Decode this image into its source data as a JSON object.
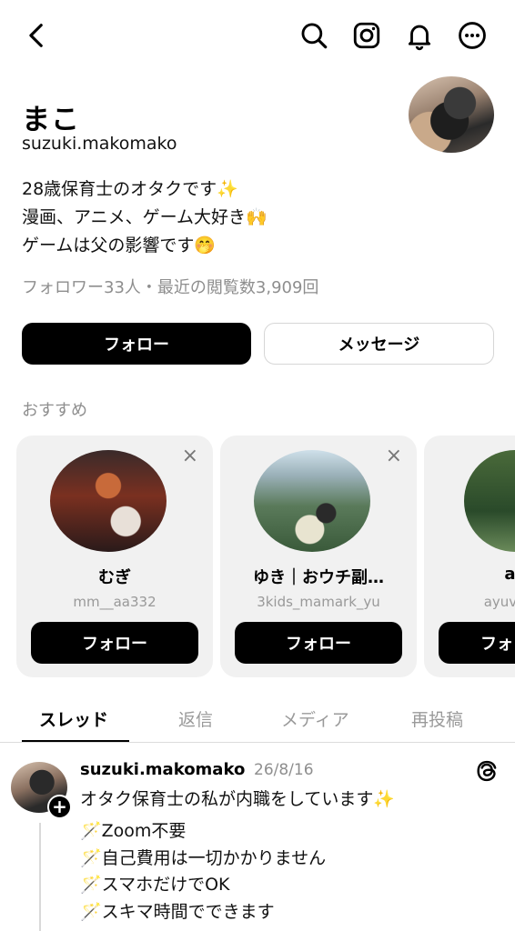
{
  "header": {
    "back_icon": "chevron-left-icon",
    "right_icons": [
      "search-icon",
      "instagram-icon",
      "bell-icon",
      "more-icon"
    ]
  },
  "profile": {
    "name": "まこ",
    "handle": "suzuki.makomako",
    "bio_lines": [
      "28歳保育士のオタクです✨",
      "漫画、アニメ、ゲーム大好き🙌",
      "ゲームは父の影響です🤭"
    ],
    "stats": "フォロワー33人・最近の閲覧数3,909回",
    "follow_label": "フォロー",
    "message_label": "メッセージ"
  },
  "recommendations": {
    "title": "おすすめ",
    "cards": [
      {
        "name": "むぎ",
        "handle": "mm__aa332",
        "follow_label": "フォロー",
        "close": "×"
      },
      {
        "name": "ゆき｜おウチ副…",
        "handle": "3kids_mamark_yu",
        "follow_label": "フォロー",
        "close": "×"
      },
      {
        "name": "ay",
        "handle": "ayuvi",
        "follow_label": "フォ",
        "close": "×"
      }
    ]
  },
  "tabs": [
    "スレッド",
    "返信",
    "メディア",
    "再投稿"
  ],
  "post": {
    "username": "suzuki.makomako",
    "date": "26/8/16",
    "text": "オタク保育士の私が内職をしています✨",
    "list": [
      "🪄Zoom不要",
      "🪄自己費用は一切かかりません",
      "🪄スマホだけでOK",
      "🪄スキマ時間でできます"
    ],
    "plus": "+"
  }
}
